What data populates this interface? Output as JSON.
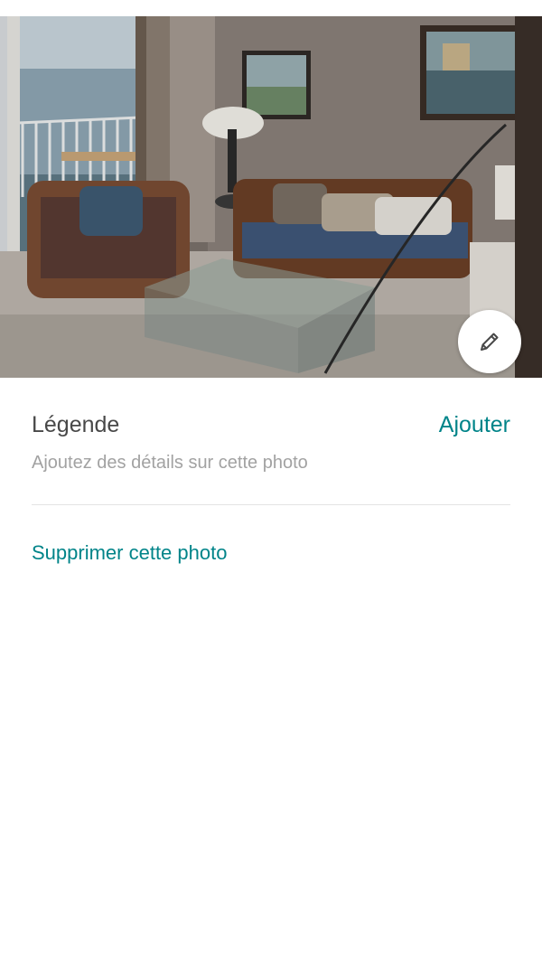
{
  "photo": {
    "subject": "living-room-photo"
  },
  "edit_button": {
    "icon": "pencil-icon"
  },
  "caption": {
    "label": "Légende",
    "add_label": "Ajouter",
    "hint": "Ajoutez des détails sur cette photo"
  },
  "actions": {
    "delete_label": "Supprimer cette photo"
  },
  "colors": {
    "accent": "#008489",
    "text_primary": "#484848",
    "text_secondary": "#a2a2a2",
    "divider": "#e4e4e4"
  }
}
